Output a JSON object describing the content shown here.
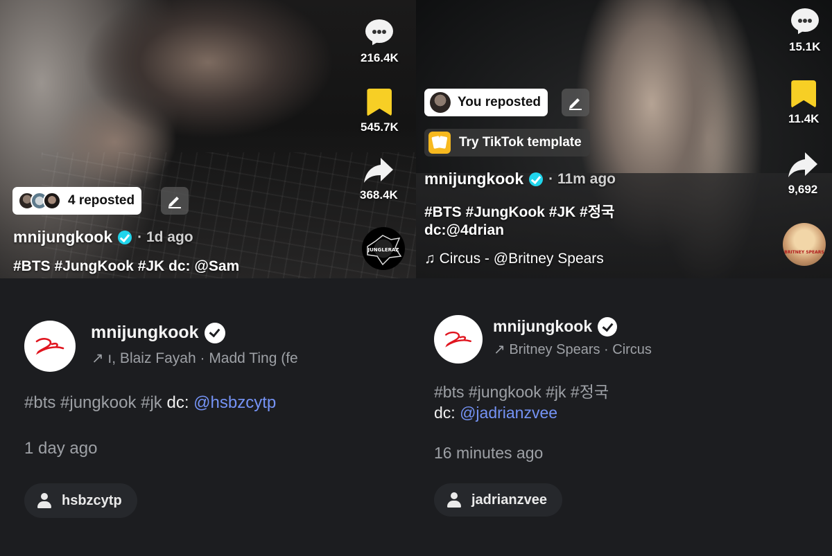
{
  "top_left": {
    "comments_count": "216.4K",
    "saves_count": "545.7K",
    "shares_count": "368.4K",
    "repost_label": "4 reposted",
    "username": "mnijungkook",
    "time_ago": "· 1d ago",
    "caption": "#BTS #JungKook #JK dc: @Sam",
    "disc_text": "JUNGLERAZ"
  },
  "top_right": {
    "comments_count": "15.1K",
    "saves_count": "11.4K",
    "shares_count": "9,692",
    "repost_label": "You reposted",
    "template_label": "Try TikTok template",
    "username": "mnijungkook",
    "time_ago": "· 11m ago",
    "caption_line1": "#BTS #JungKook #JK #정국",
    "caption_line2": "dc:@4drian",
    "music": "♫ Circus - @Britney Spears",
    "disc_text": "BRITNEY SPEARS"
  },
  "bottom_left": {
    "username": "mnijungkook",
    "sound": "↗ ı, Blaiz Fayah · Madd Ting (fe",
    "tags": "#bts #jungkook #jk",
    "dc_label": "dc:",
    "dc_handle": "@hsbzcytp",
    "time": "1 day ago",
    "credit_chip": "hsbzcytp"
  },
  "bottom_right": {
    "username": "mnijungkook",
    "sound": "↗ Britney Spears · Circus",
    "tags": "#bts #jungkook #jk #정국",
    "dc_label": "dc:",
    "dc_handle": "@jadrianzvee",
    "time": "16 minutes ago",
    "credit_chip": "jadrianzvee"
  },
  "colors": {
    "save_yellow": "#f7cf25",
    "verified_cyan": "#20d5ec",
    "link_blue": "#7593f5",
    "brand_red": "#e0141e"
  },
  "icons": [
    "comment-icon",
    "bookmark-icon",
    "share-icon",
    "pencil-icon",
    "template-icon",
    "verified-icon",
    "arrow-icon",
    "person-icon"
  ]
}
